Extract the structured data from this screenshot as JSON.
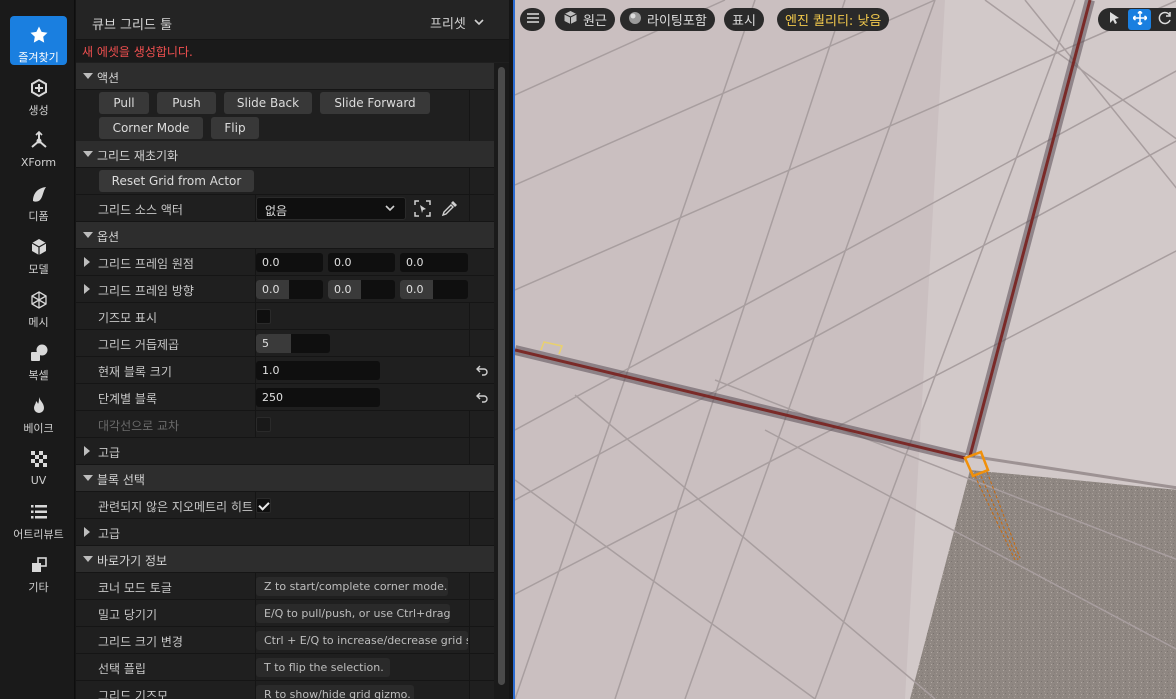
{
  "modes": [
    {
      "label": "즐겨찾기",
      "icon": "star-icon",
      "active": true
    },
    {
      "label": "생성",
      "icon": "create-icon",
      "active": false
    },
    {
      "label": "XForm",
      "icon": "xform-icon",
      "active": false
    },
    {
      "label": "디폼",
      "icon": "deform-icon",
      "active": false
    },
    {
      "label": "모델",
      "icon": "model-icon",
      "active": false
    },
    {
      "label": "메시",
      "icon": "mesh-icon",
      "active": false
    },
    {
      "label": "복셀",
      "icon": "voxel-icon",
      "active": false
    },
    {
      "label": "베이크",
      "icon": "bake-icon",
      "active": false
    },
    {
      "label": "UV",
      "icon": "uv-checker-icon",
      "active": false
    },
    {
      "label": "어트리뷰트",
      "icon": "attributes-icon",
      "active": false
    },
    {
      "label": "기타",
      "icon": "misc-icon",
      "active": false
    }
  ],
  "panel": {
    "title": "큐브 그리드 툴",
    "preset_label": "프리셋",
    "warning": "새 에셋을 생성합니다."
  },
  "actions": {
    "header": "액션",
    "buttons": [
      "Pull",
      "Push",
      "Slide Back",
      "Slide Forward",
      "Corner Mode",
      "Flip"
    ]
  },
  "grid_reinit": {
    "header": "그리드 재초기화",
    "reset_button": "Reset Grid from Actor",
    "source_actor_label": "그리드 소스 액터",
    "source_actor_value": "없음"
  },
  "options": {
    "header": "옵션",
    "frame_origin_label": "그리드 프레임 원점",
    "frame_origin": [
      "0.0",
      "0.0",
      "0.0"
    ],
    "frame_orientation_label": "그리드 프레임 방향",
    "frame_orientation": [
      "0.0",
      "0.0",
      "0.0"
    ],
    "show_gizmo_label": "기즈모 표시",
    "show_gizmo": false,
    "grid_power_label": "그리드 거듭제곱",
    "grid_power": "5",
    "current_block_size_label": "현재 블록 크기",
    "current_block_size": "1.0",
    "block_step_label": "단계별 블록",
    "block_step": "250",
    "diagonal_label": "대각선으로 교차",
    "diagonal": false,
    "advanced_label": "고급"
  },
  "block_selection": {
    "header": "블록 선택",
    "hit_unrelated_label": "관련되지 않은 지오메트리 히트",
    "hit_unrelated": true,
    "advanced_label": "고급"
  },
  "shortcuts": {
    "header": "바로가기 정보",
    "items": [
      {
        "label": "코너 모드 토글",
        "value": "Z to start/complete corner mode."
      },
      {
        "label": "밀고 당기기",
        "value": "E/Q to pull/push, or use Ctrl+drag."
      },
      {
        "label": "그리드 크기 변경",
        "value": "Ctrl + E/Q to increase/decrease grid s"
      },
      {
        "label": "선택 플립",
        "value": "T to flip the selection."
      },
      {
        "label": "그리드 기즈모",
        "value": "R to show/hide grid gizmo."
      }
    ]
  },
  "viewport": {
    "perspective": "원근",
    "lighting": "라이팅포함",
    "show": "표시",
    "quality": "엔진 퀄리티: 낮음"
  },
  "colors": {
    "accent": "#1a7fe0",
    "warning": "#f05050",
    "quality": "#f2c94c",
    "grid_axis": "#7a2a28",
    "selection": "#f0900a"
  }
}
